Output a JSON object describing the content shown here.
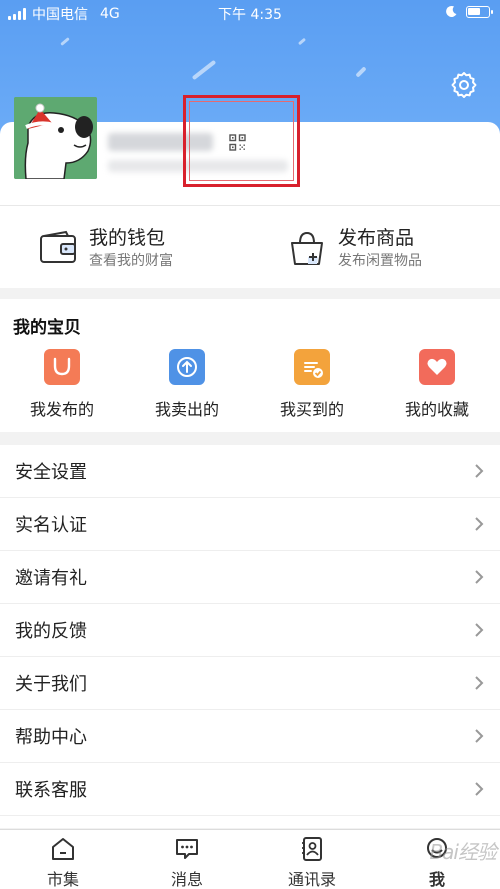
{
  "status_bar": {
    "carrier": "中国电信",
    "network": "4G",
    "time": "下午 4:35"
  },
  "quick_actions": [
    {
      "title": "我的钱包",
      "subtitle": "查看我的财富",
      "icon": "wallet-icon"
    },
    {
      "title": "发布商品",
      "subtitle": "发布闲置物品",
      "icon": "shopping-bag-plus-icon"
    }
  ],
  "my_items": {
    "title": "我的宝贝",
    "items": [
      {
        "label": "我发布的",
        "icon": "bag-icon",
        "color": "#f47b56"
      },
      {
        "label": "我卖出的",
        "icon": "upload-arrow-icon",
        "color": "#4f92e6"
      },
      {
        "label": "我买到的",
        "icon": "receipt-check-icon",
        "color": "#f3a33c"
      },
      {
        "label": "我的收藏",
        "icon": "heart-icon",
        "color": "#f26b5b"
      }
    ]
  },
  "menu": [
    {
      "label": "安全设置"
    },
    {
      "label": "实名认证"
    },
    {
      "label": "邀请有礼"
    },
    {
      "label": "我的反馈"
    },
    {
      "label": "关于我们"
    },
    {
      "label": "帮助中心"
    },
    {
      "label": "联系客服"
    }
  ],
  "tabs": [
    {
      "label": "市集",
      "icon": "home-icon"
    },
    {
      "label": "消息",
      "icon": "chat-icon"
    },
    {
      "label": "通讯录",
      "icon": "contacts-icon"
    },
    {
      "label": "我",
      "icon": "profile-icon"
    }
  ],
  "watermark": "Bai经验"
}
